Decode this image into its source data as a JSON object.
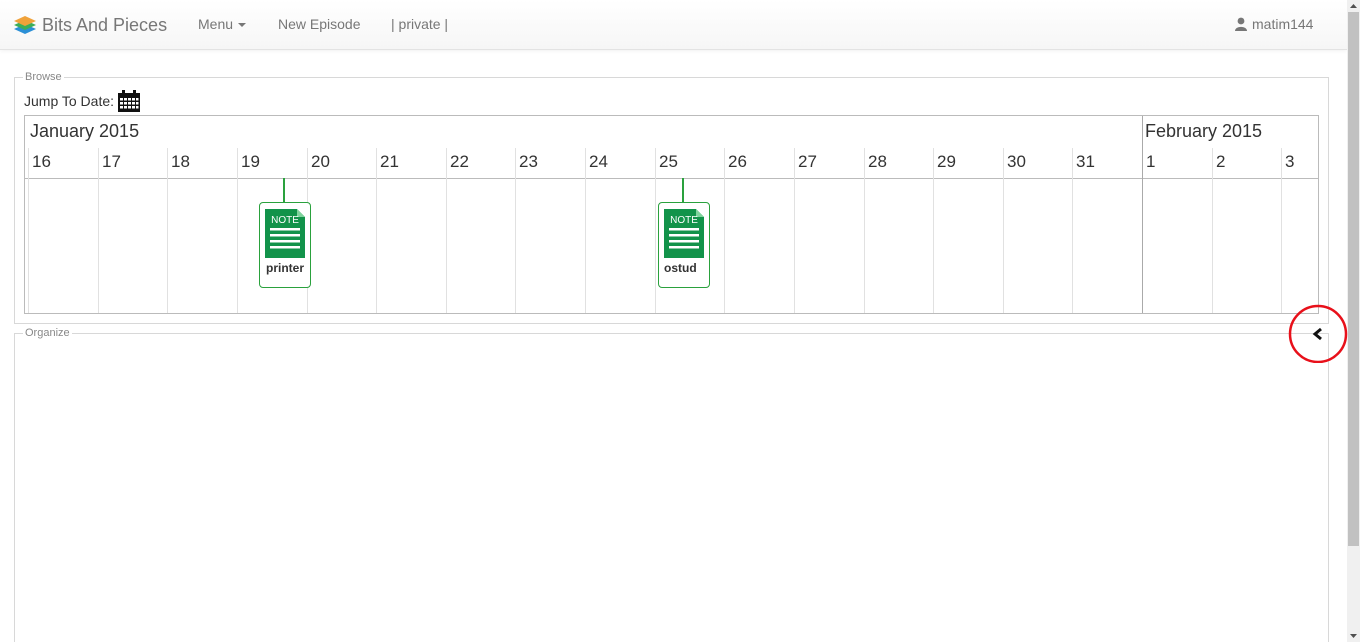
{
  "navbar": {
    "brand": "Bits And Pieces",
    "menu_label": "Menu",
    "new_episode_label": "New Episode",
    "private_label": "| private |",
    "username": "matim144"
  },
  "browse": {
    "legend": "Browse",
    "jump_to_date_label": "Jump To Date:"
  },
  "timeline": {
    "months": [
      "January 2015",
      "February 2015"
    ],
    "days": [
      "16",
      "17",
      "18",
      "19",
      "20",
      "21",
      "22",
      "23",
      "24",
      "25",
      "26",
      "27",
      "28",
      "29",
      "30",
      "31",
      "1",
      "2",
      "3"
    ],
    "events": [
      {
        "title": "printer",
        "icon_text": "NOTE",
        "day": "19"
      },
      {
        "title": "ostud",
        "icon_text": "NOTE",
        "day": "25"
      }
    ]
  },
  "organize": {
    "legend": "Organize"
  },
  "colors": {
    "event_green": "#2aa13d",
    "note_green": "#12934a",
    "highlight_red": "#e8101a"
  },
  "icons": {
    "brand": "layers-logo-icon",
    "user": "user-icon",
    "calendar": "calendar-icon",
    "note": "note-document-icon",
    "collapse": "chevron-left-icon"
  }
}
